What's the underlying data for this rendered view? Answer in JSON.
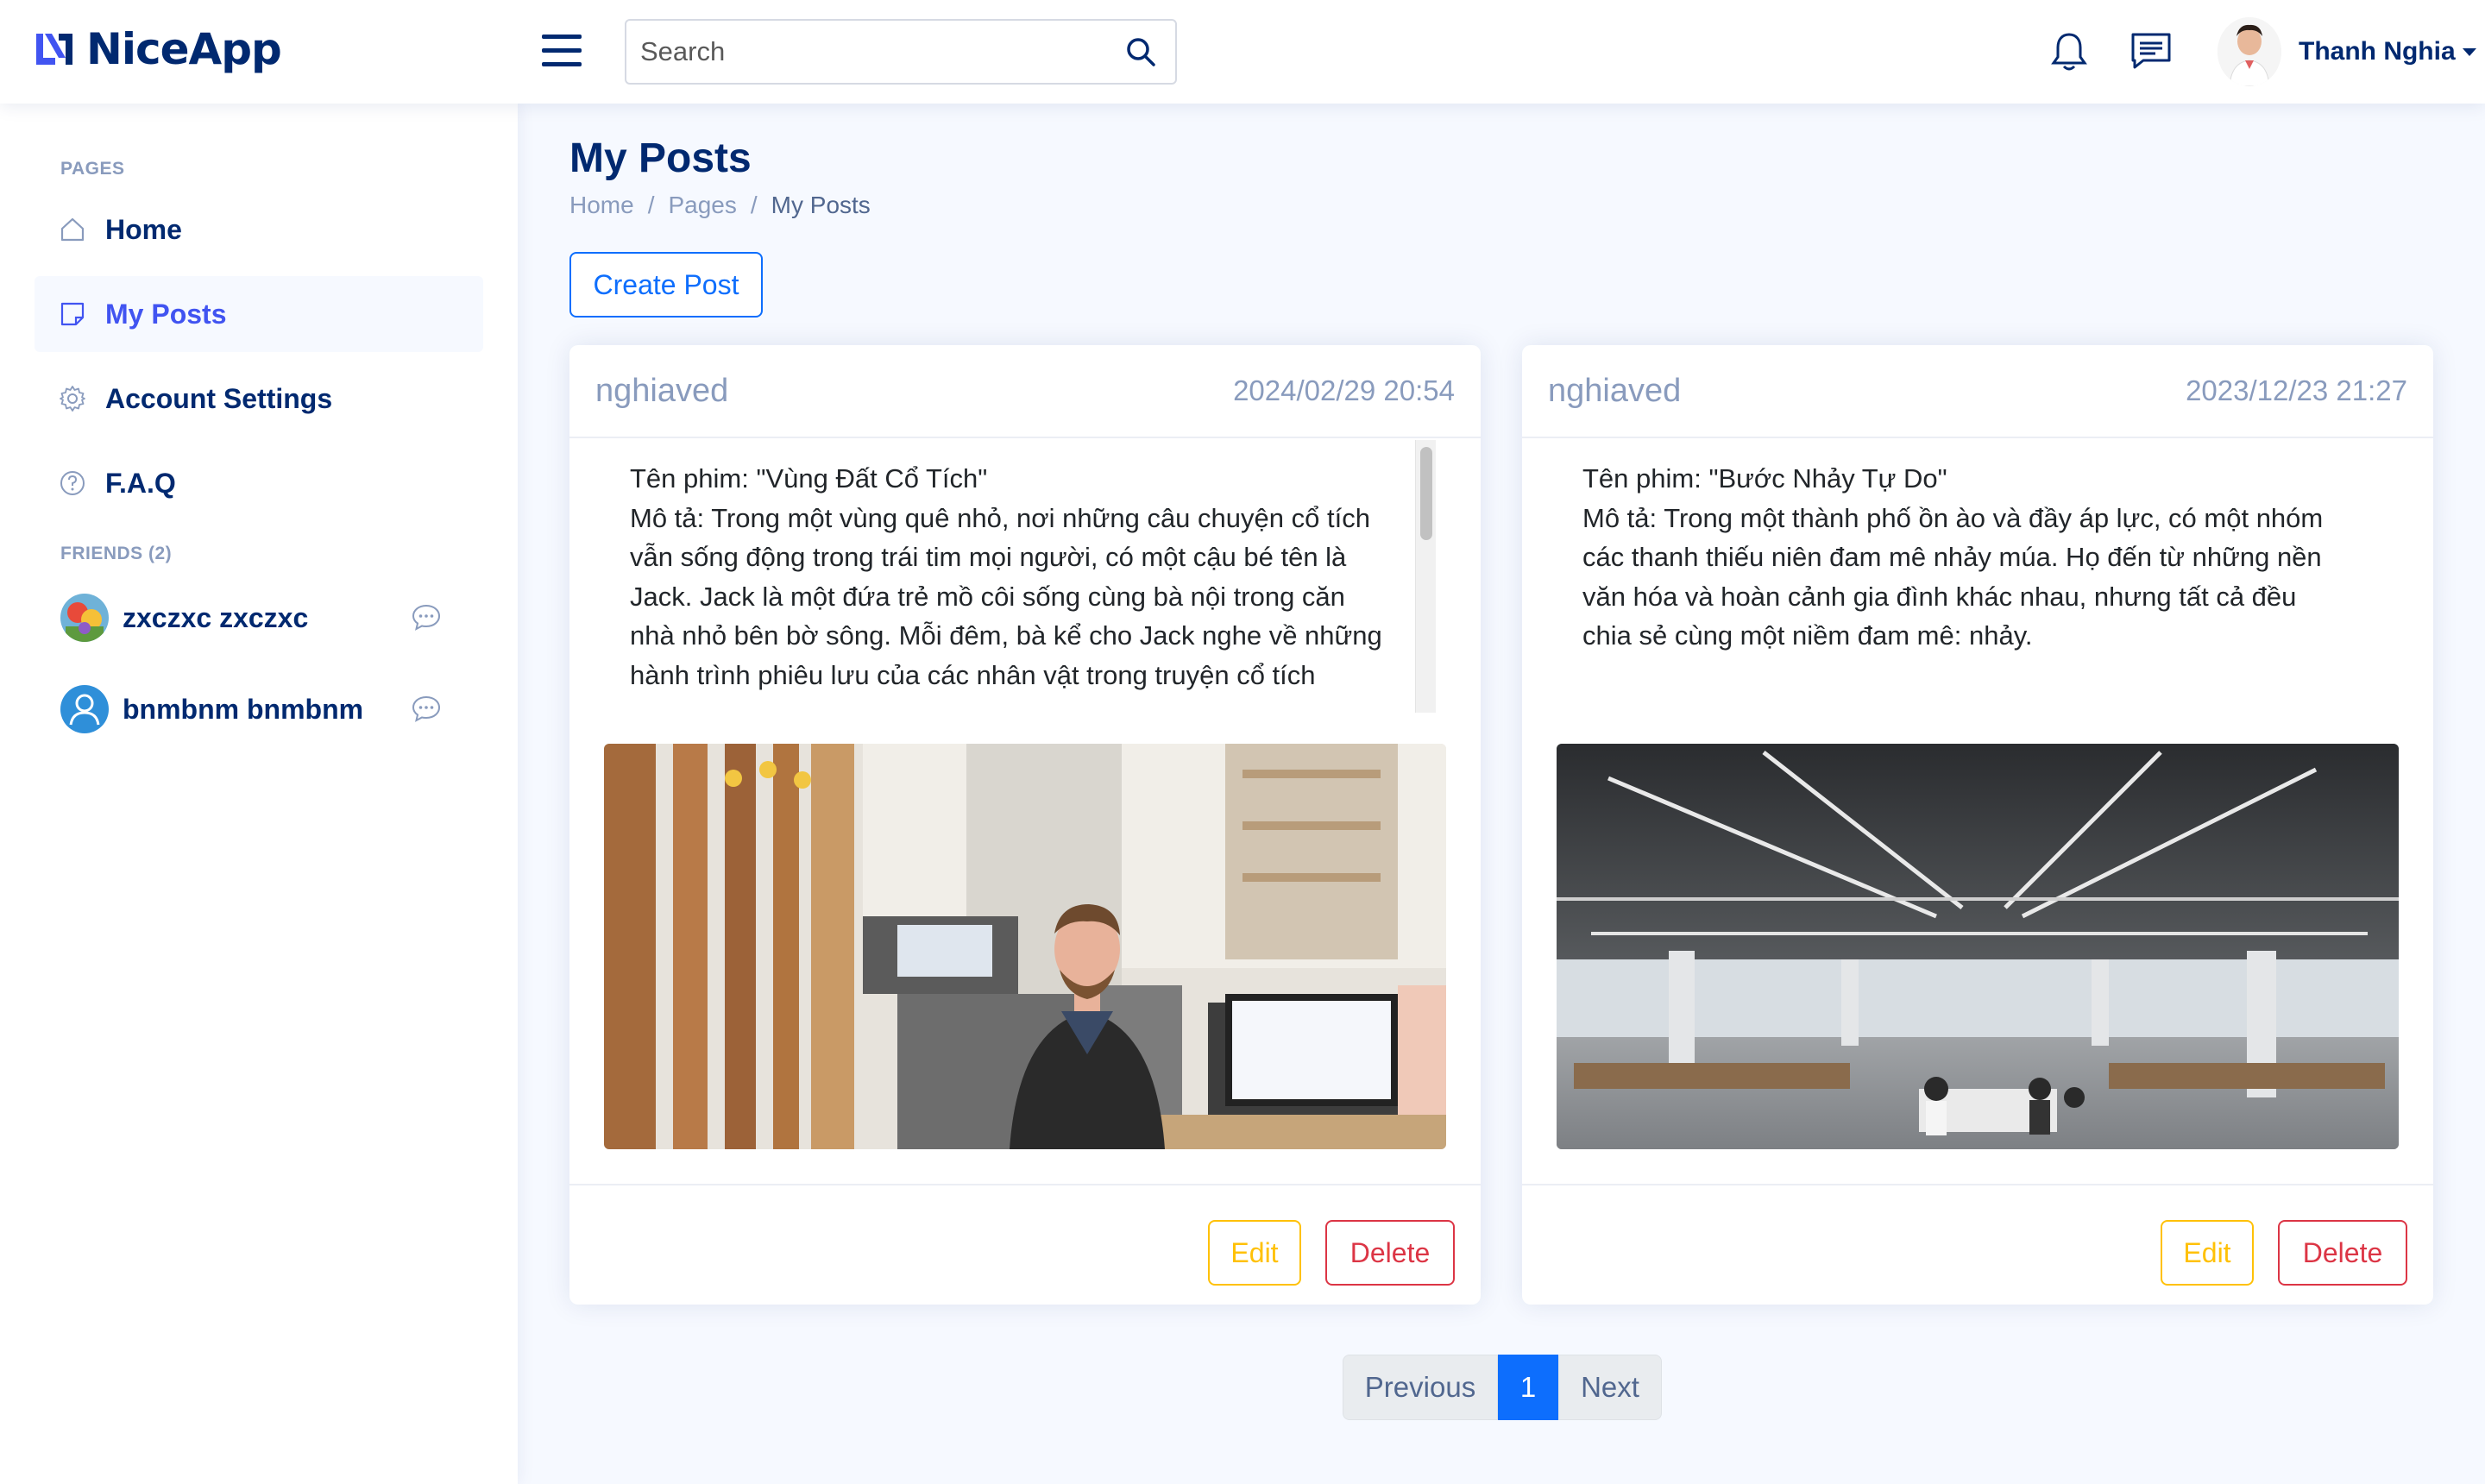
{
  "app": {
    "name": "NiceApp"
  },
  "header": {
    "search_placeholder": "Search",
    "user_name": "Thanh Nghia"
  },
  "sidebar": {
    "pages_heading": "PAGES",
    "items": [
      {
        "label": "Home",
        "icon": "home-icon"
      },
      {
        "label": "My Posts",
        "icon": "posts-icon",
        "active": true
      },
      {
        "label": "Account Settings",
        "icon": "gear-icon"
      },
      {
        "label": "F.A.Q",
        "icon": "question-icon"
      }
    ],
    "friends_heading": "FRIENDS (2)",
    "friends": [
      {
        "name": "zxczxc zxczxc",
        "avatar": "game-avatar"
      },
      {
        "name": "bnmbnm bnmbnm",
        "avatar": "default-user-avatar"
      }
    ]
  },
  "main": {
    "title": "My Posts",
    "breadcrumb": [
      "Home",
      "Pages",
      "My Posts"
    ],
    "create_label": "Create Post"
  },
  "posts": [
    {
      "author": "nghiaved",
      "date": "2024/02/29 20:54",
      "content": "Tên phim: \"Vùng Đất Cổ Tích\"\nMô tả: Trong một vùng quê nhỏ, nơi những câu chuyện cổ tích vẫn sống động trong trái tim mọi người, có một cậu bé tên là Jack. Jack là một đứa trẻ mồ côi sống cùng bà nội trong căn nhà nhỏ bên bờ sông. Mỗi đêm, bà kể cho Jack nghe về những hành trình phiêu lưu của các nhân vật trong truyện cổ tích",
      "image": "office-man-smiling-photo",
      "edit_label": "Edit",
      "delete_label": "Delete"
    },
    {
      "author": "nghiaved",
      "date": "2023/12/23 21:27",
      "content": "Tên phim: \"Bước Nhảy Tự Do\"\nMô tả: Trong một thành phố ồn ào và đầy áp lực, có một nhóm các thanh thiếu niên đam mê nhảy múa. Họ đến từ những nền văn hóa và hoàn cảnh gia đình khác nhau, nhưng tất cả đều chia sẻ cùng một niềm đam mê: nhảy.",
      "image": "open-office-interior-photo",
      "edit_label": "Edit",
      "delete_label": "Delete"
    }
  ],
  "pagination": {
    "prev": "Previous",
    "current": "1",
    "next": "Next"
  },
  "colors": {
    "primary": "#4154f1",
    "navy": "#012970",
    "muted": "#899bbd",
    "blue": "#0d6efd",
    "warning": "#ffc107",
    "danger": "#dc3545"
  }
}
